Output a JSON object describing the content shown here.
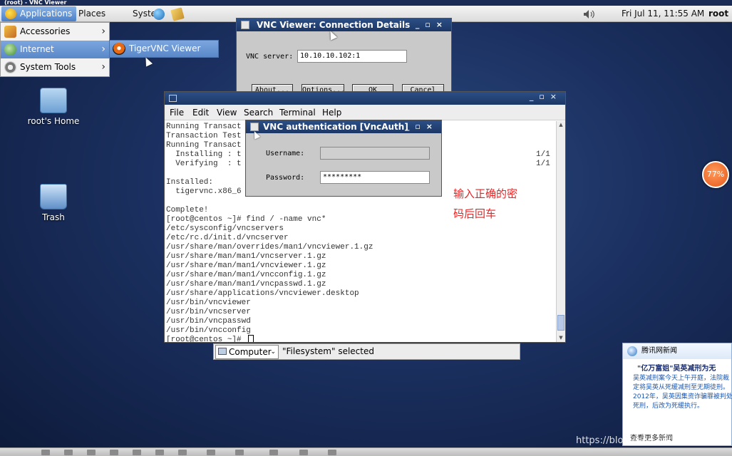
{
  "vnc_window_title": "(root) - VNC Viewer",
  "panel": {
    "menus": [
      "Applications",
      "Places",
      "System"
    ],
    "clock": "Fri Jul 11, 11:55 AM",
    "user": "root"
  },
  "app_menu": {
    "items": [
      {
        "label": "Accessories"
      },
      {
        "label": "Internet"
      },
      {
        "label": "System Tools"
      }
    ],
    "submenu_item": "TigerVNC Viewer"
  },
  "desktop": {
    "icons": [
      {
        "label": "root's Home"
      },
      {
        "label": "Trash"
      }
    ]
  },
  "vnc_dialog": {
    "title": "VNC Viewer: Connection Details",
    "server_label": "VNC server:",
    "server_value": "10.10.10.102:1",
    "buttons": [
      "About...",
      "Options...",
      "OK",
      "Cancel"
    ]
  },
  "terminal": {
    "menus": [
      "File",
      "Edit",
      "View",
      "Search",
      "Terminal",
      "Help"
    ],
    "lines": [
      "Running Transact",
      "Transaction Test",
      "Running Transact",
      "  Installing : t",
      "  Verifying  : t",
      "",
      "Installed:",
      "  tigervnc.x86_6",
      "",
      "Complete!",
      "[root@centos ~]# find / -name vnc*",
      "/etc/sysconfig/vncservers",
      "/etc/rc.d/init.d/vncserver",
      "/usr/share/man/overrides/man1/vncviewer.1.gz",
      "/usr/share/man/man1/vncserver.1.gz",
      "/usr/share/man/man1/vncviewer.1.gz",
      "/usr/share/man/man1/vncconfig.1.gz",
      "/usr/share/man/man1/vncpasswd.1.gz",
      "/usr/share/applications/vncviewer.desktop",
      "/usr/bin/vncviewer",
      "/usr/bin/vncserver",
      "/usr/bin/vncpasswd",
      "/usr/bin/vncconfig",
      "[root@centos ~]# "
    ],
    "right_counts": [
      "1/1",
      "1/1"
    ]
  },
  "auth_dialog": {
    "title": "VNC authentication [VncAuth]",
    "username_label": "Username:",
    "password_label": "Password:",
    "password_value": "*********"
  },
  "annotation": {
    "line1": "输入正确的密",
    "line2": "码后回车"
  },
  "statusbar": {
    "combo_value": "Computer",
    "text": "\"Filesystem\" selected"
  },
  "battery": {
    "value": "77%"
  },
  "news_popup": {
    "header": "腾讯网新闻",
    "title": "\"亿万富姐\"吴英减刑为无",
    "body": "吴英减刑案今天上午开庭，法院裁定将吴英从死缓减刑至无期徒刑。2012年，吴英因集资诈骗罪被判处死刑，后改为死缓执行。",
    "more": "查看更多新闻"
  },
  "watermark": "https://blog.csdn.net/tatianyui"
}
